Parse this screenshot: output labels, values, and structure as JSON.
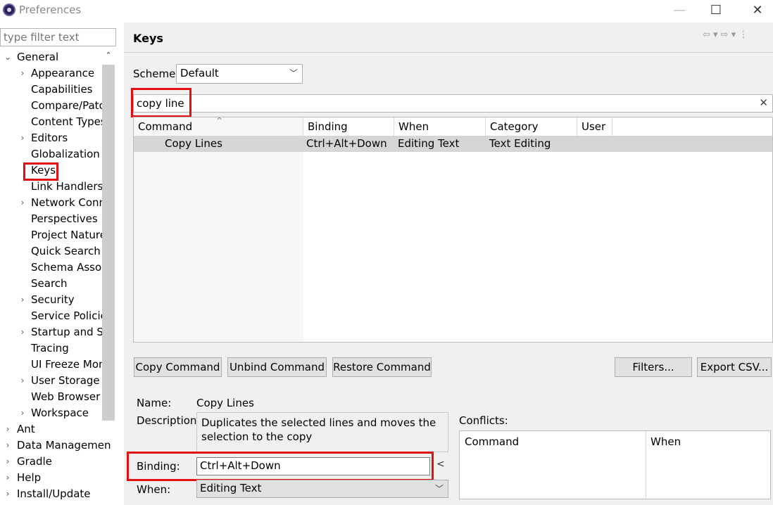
{
  "window": {
    "title": "Preferences",
    "minimize": "—",
    "maximize": "☐",
    "close": "✕"
  },
  "sidebar": {
    "filter_placeholder": "type filter text",
    "items": [
      {
        "label": "General",
        "expand": "⌄"
      },
      {
        "label": "Appearance",
        "expand": "›"
      },
      {
        "label": "Capabilities",
        "expand": ""
      },
      {
        "label": "Compare/Patch",
        "expand": ""
      },
      {
        "label": "Content Types",
        "expand": ""
      },
      {
        "label": "Editors",
        "expand": "›"
      },
      {
        "label": "Globalization",
        "expand": ""
      },
      {
        "label": "Keys",
        "expand": ""
      },
      {
        "label": "Link Handlers",
        "expand": ""
      },
      {
        "label": "Network Conn",
        "expand": "›"
      },
      {
        "label": "Perspectives",
        "expand": ""
      },
      {
        "label": "Project Natures",
        "expand": ""
      },
      {
        "label": "Quick Search",
        "expand": ""
      },
      {
        "label": "Schema Associ",
        "expand": ""
      },
      {
        "label": "Search",
        "expand": ""
      },
      {
        "label": "Security",
        "expand": "›"
      },
      {
        "label": "Service Policies",
        "expand": ""
      },
      {
        "label": "Startup and Sh",
        "expand": "›"
      },
      {
        "label": "Tracing",
        "expand": ""
      },
      {
        "label": "UI Freeze Mon",
        "expand": ""
      },
      {
        "label": "User Storage S",
        "expand": "›"
      },
      {
        "label": "Web Browser",
        "expand": ""
      },
      {
        "label": "Workspace",
        "expand": "›"
      },
      {
        "label": "Ant",
        "expand": "›"
      },
      {
        "label": "Data Managemen",
        "expand": "›"
      },
      {
        "label": "Gradle",
        "expand": "›"
      },
      {
        "label": "Help",
        "expand": "›"
      },
      {
        "label": "Install/Update",
        "expand": "›"
      }
    ]
  },
  "page": {
    "title": "Keys",
    "nav_icons": "⇦ ▾ ⇨ ▾ ⋮",
    "scheme_label": "Scheme:",
    "scheme_value": "Default",
    "filter_value": "copy line",
    "filter_clear": "✕"
  },
  "table": {
    "headers": [
      "Command",
      "Binding",
      "When",
      "Category",
      "User"
    ],
    "rows": [
      {
        "command": "Copy Lines",
        "binding": "Ctrl+Alt+Down",
        "when": "Editing Text",
        "category": "Text Editing",
        "user": ""
      }
    ]
  },
  "buttons": {
    "copy_command": "Copy Command",
    "unbind_command": "Unbind Command",
    "restore_command": "Restore Command",
    "filters": "Filters...",
    "export_csv": "Export CSV..."
  },
  "details": {
    "name_label": "Name:",
    "name_value": "Copy Lines",
    "description_label": "Description:",
    "description_value": "Duplicates the selected lines and moves the selection to the copy",
    "binding_label": "Binding:",
    "binding_value": "Ctrl+Alt+Down",
    "binding_menu": "<",
    "when_label": "When:",
    "when_value": "Editing Text",
    "conflicts_label": "Conflicts:",
    "conflicts_headers": [
      "Command",
      "When"
    ]
  },
  "colors": {
    "highlight": "#e01010",
    "selection": "#d6d6d6",
    "panel": "#f0f0f0"
  }
}
